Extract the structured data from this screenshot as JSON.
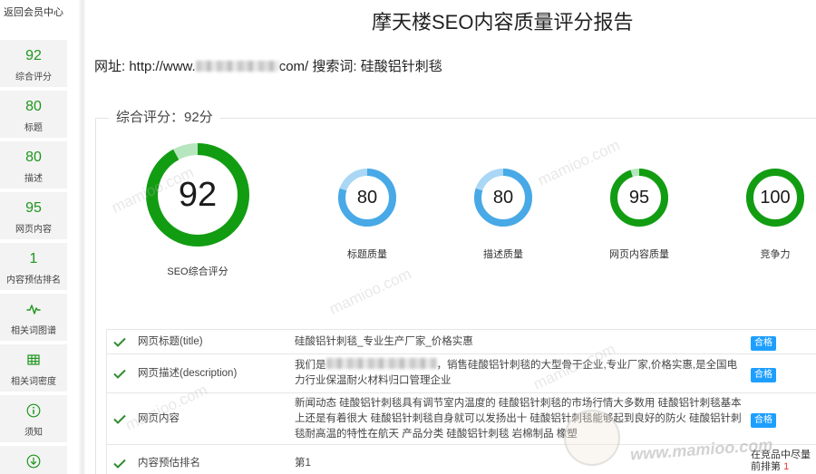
{
  "theme": {
    "accent": "#1e961e",
    "badge": "#1e9fff",
    "rank_highlight": "#e53935"
  },
  "sidebar": {
    "back_label": "返回会员中心",
    "items": [
      {
        "value": "92",
        "label": "综合评分"
      },
      {
        "value": "80",
        "label": "标题"
      },
      {
        "value": "80",
        "label": "描述"
      },
      {
        "value": "95",
        "label": "网页内容"
      },
      {
        "value": "1",
        "label": "内容预估排名"
      },
      {
        "icon": "pulse-icon",
        "label": "相关词图谱"
      },
      {
        "icon": "grid-icon",
        "label": "相关词密度"
      },
      {
        "icon": "info-icon",
        "label": "须知"
      },
      {
        "icon": "download-icon"
      }
    ]
  },
  "header": {
    "title": "摩天楼SEO内容质量评分报告",
    "url_label": "网址:",
    "url_prefix": "http://www.",
    "url_suffix": "com/",
    "keyword_label": "搜索词:",
    "keyword": "硅酸铝针刺毯"
  },
  "overall": {
    "legend": "综合评分：92分",
    "gauges": [
      {
        "value": 92,
        "label": "SEO综合评分",
        "color": "#129c12",
        "track_color": "#b6e6bd"
      },
      {
        "value": 80,
        "label": "标题质量",
        "color": "#48a9e6",
        "track_color": "#a9d7f5"
      },
      {
        "value": 80,
        "label": "描述质量",
        "color": "#48a9e6",
        "track_color": "#a9d7f5"
      },
      {
        "value": 95,
        "label": "网页内容质量",
        "color": "#129c12",
        "track_color": "#b6e6bd"
      },
      {
        "value": 100,
        "label": "竞争力",
        "color": "#129c12",
        "track_color": "#b6e6bd"
      }
    ]
  },
  "results": {
    "rows": [
      {
        "name": "网页标题(title)",
        "value": "硅酸铝针刺毯_专业生产厂家_价格实惠",
        "status": "合格"
      },
      {
        "name": "网页描述(description)",
        "value_prefix": "我们是",
        "value_suffix": "，销售硅酸铝针刺毯的大型骨干企业,专业厂家,价格实惠,是全国电力行业保温耐火材料归口管理企业",
        "status": "合格"
      },
      {
        "name": "网页内容",
        "value": "新闻动态 硅酸铝针刺毯具有调节室内温度的 硅酸铝针刺毯的市场行情大多数用 硅酸铝针刺毯基本上还是有着很大 硅酸铝针刺毯自身就可以发扬出十 硅酸铝针刺毯能够起到良好的防火 硅酸铝针刺毯耐高温的特性在航天 产品分类 硅酸铝针刺毯 岩棉制品 橡塑",
        "status": "合格"
      },
      {
        "name": "内容预估排名",
        "value": "第1",
        "note": "在竞品中尽量",
        "note_rank_label": "前排第",
        "note_rank": "1"
      }
    ]
  },
  "watermark": {
    "text": "mamioo.com",
    "url": "www.mamioo.com"
  }
}
